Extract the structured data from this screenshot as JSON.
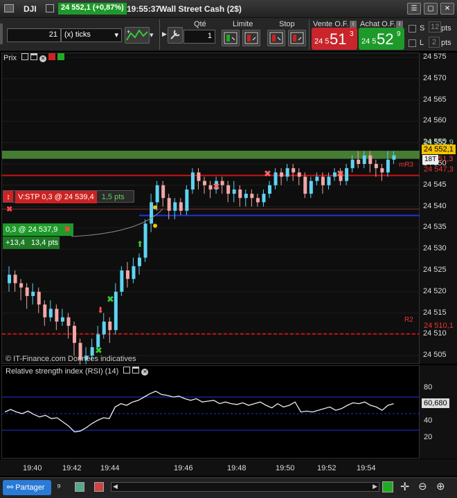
{
  "titlebar": {
    "symbol": "DJI",
    "change": "24 552,1 (+0,87%)",
    "time": "19:55:37",
    "instrument": "Wall Street Cash (2$)"
  },
  "toolbar": {
    "ticks_value": "21",
    "ticks_unit": "(x) ticks",
    "qty_label": "Qté",
    "qty_value": "1",
    "limit_label": "Limite",
    "stop_label": "Stop",
    "sell_label": "Vente O.F.",
    "sell_prefix": "24 5",
    "sell_big": "51",
    "sell_sup": "3",
    "buy_label": "Achat O.F.",
    "buy_prefix": "24 5",
    "buy_big": "52",
    "buy_sup": "9",
    "s_label": "S",
    "s_value": "12",
    "l_label": "L",
    "l_value": "2",
    "pts": "pts"
  },
  "chart": {
    "panel_title": "Prix",
    "watermark": "© IT-Finance.com  Données indicatives",
    "price_ticks": [
      "24 575",
      "24 570",
      "24 565",
      "24 560",
      "24 555",
      "24 550",
      "24 545",
      "24 540",
      "24 535",
      "24 530",
      "24 525",
      "24 520",
      "24 515",
      "24 510",
      "24 505"
    ],
    "tag_upper": "24 552,9",
    "tag_current": "24 552,1",
    "tag_18t": "18T",
    "tag_513": "51,3",
    "tag_mr3_label": "mR3",
    "tag_mr3": "24 547,3",
    "tag_r2_label": "R2",
    "tag_r2": "24 510,1",
    "stop_order": "V:STP  0,3 @ 24 539,4",
    "stop_pts": "1,5 pts",
    "pos_order": "0,3 @ 24 537,9",
    "pos_pl": "+13,4",
    "pos_pts": "13,4 pts"
  },
  "rsi": {
    "title": "Relative strength index (RSI) (14)",
    "ticks": [
      "80",
      "60",
      "40",
      "20"
    ],
    "value": "60,680"
  },
  "time_axis": [
    "19:40",
    "19:42",
    "19:44",
    "19:46",
    "19:48",
    "19:50",
    "19:52",
    "19:54"
  ],
  "status": {
    "share": "Partager"
  },
  "colors": {
    "up": "#5fd3f2",
    "down": "#f2a6a6",
    "sell": "#c9252b",
    "buy": "#1e9a2a",
    "resistance": "#cc1111",
    "support_blue": "#2233dd"
  }
}
